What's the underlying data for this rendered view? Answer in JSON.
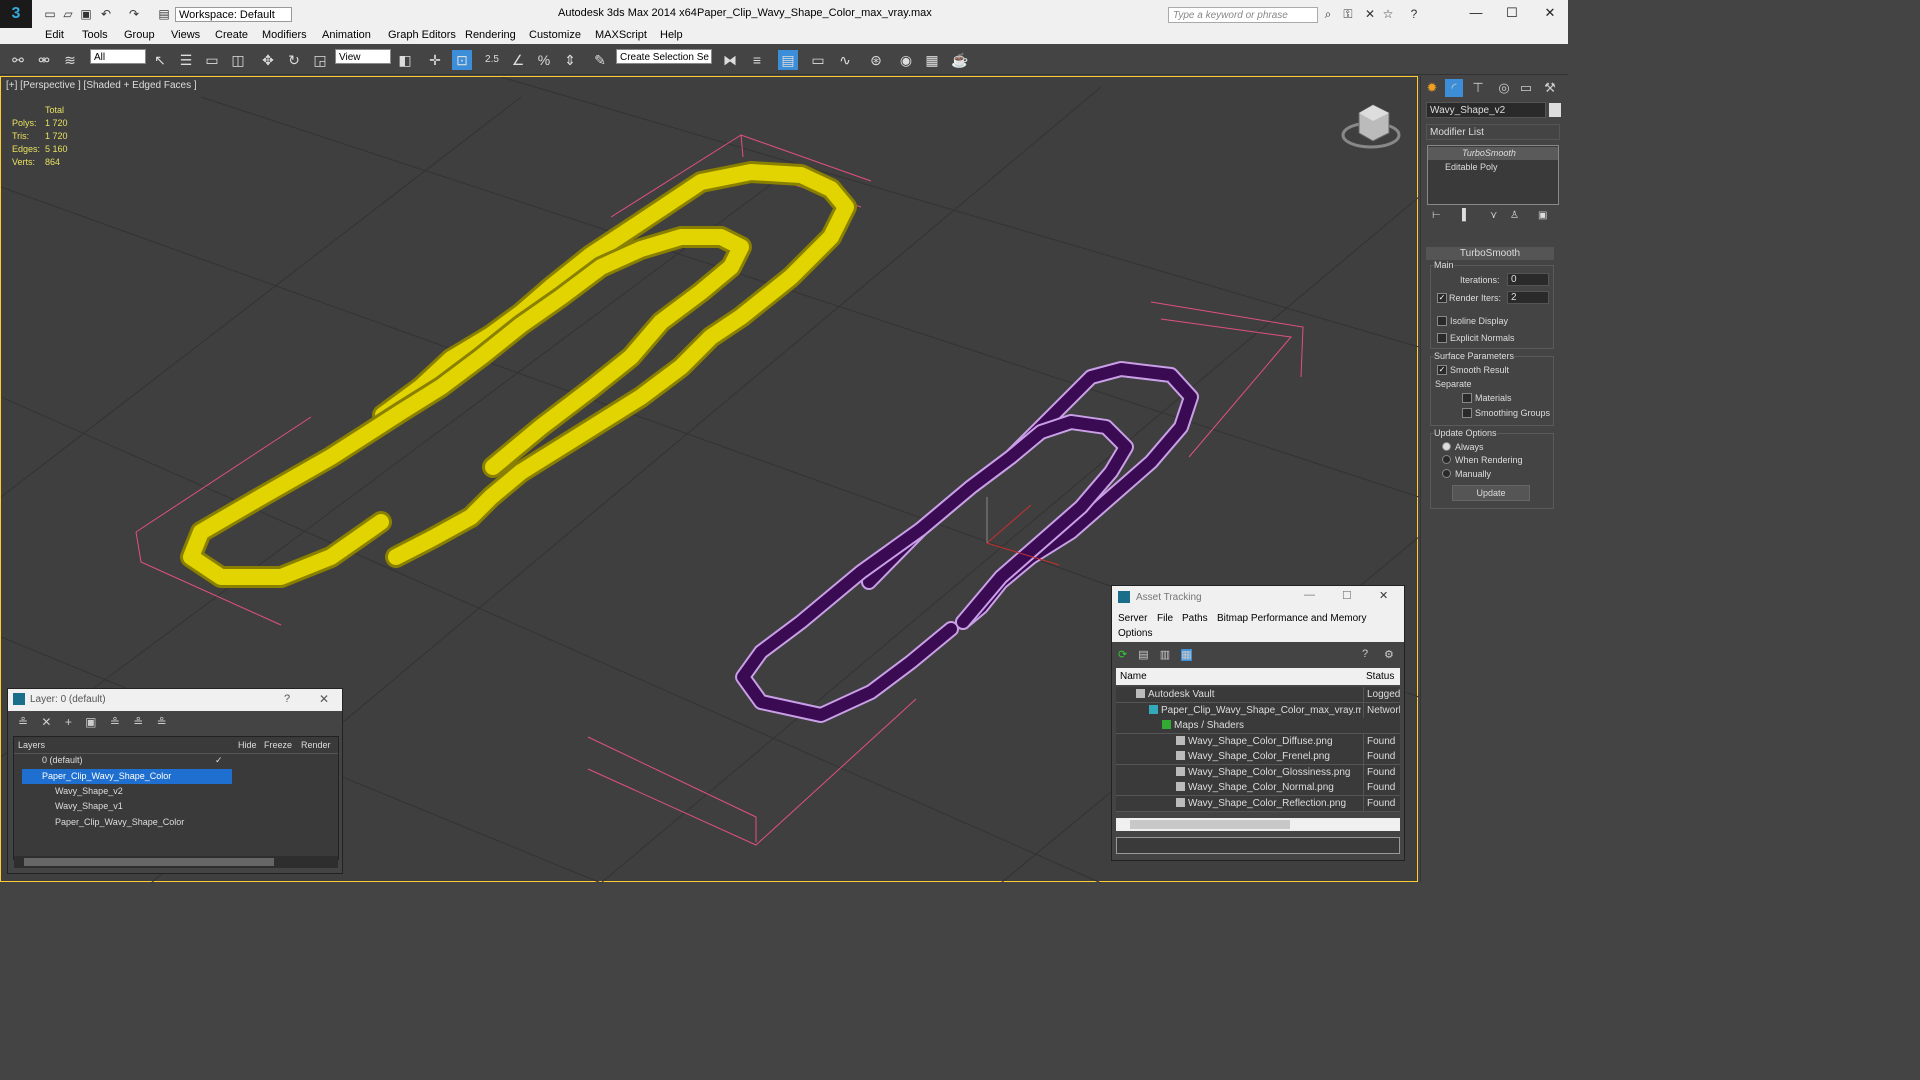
{
  "titlebar": {
    "app_title": "Autodesk 3ds Max  2014 x64",
    "file_title": "Paper_Clip_Wavy_Shape_Color_max_vray.max",
    "workspace": "Workspace: Default",
    "search_placeholder": "Type a keyword or phrase",
    "minimize": "—",
    "maximize": "☐",
    "close": "✕"
  },
  "menu": [
    "Edit",
    "Tools",
    "Group",
    "Views",
    "Create",
    "Modifiers",
    "Animation",
    "Graph Editors",
    "Rendering",
    "Customize",
    "MAXScript",
    "Help"
  ],
  "toolbar": {
    "filter_value": "All",
    "refcoord_value": "View",
    "selection_set": "Create Selection Se",
    "snap_label": "2.5"
  },
  "viewport": {
    "label": "[+] [Perspective ] [Shaded + Edged Faces ]",
    "stats": {
      "header": "Total",
      "rows": [
        {
          "label": "Polys:",
          "value": "1 720"
        },
        {
          "label": "Tris:",
          "value": "1 720"
        },
        {
          "label": "Edges:",
          "value": "5 160"
        },
        {
          "label": "Verts:",
          "value": "864"
        }
      ]
    }
  },
  "command_panel": {
    "object_name": "Wavy_Shape_v2",
    "modifier_list": "Modifier List",
    "stack": [
      "TurboSmooth",
      "Editable Poly"
    ],
    "turbosmooth": {
      "title": "TurboSmooth",
      "main": "Main",
      "iterations_label": "Iterations:",
      "iterations_value": "0",
      "render_iters_label": "Render Iters:",
      "render_iters_value": "2",
      "isoline": "Isoline Display",
      "explicit_normals": "Explicit Normals",
      "surface_params": "Surface Parameters",
      "smooth_result": "Smooth Result",
      "separate": "Separate",
      "materials": "Materials",
      "smoothing_groups": "Smoothing Groups",
      "update_options": "Update Options",
      "always": "Always",
      "when_rendering": "When Rendering",
      "manually": "Manually",
      "update_button": "Update"
    }
  },
  "layer_panel": {
    "title": "Layer: 0 (default)",
    "help": "?",
    "close": "✕",
    "columns": [
      "Layers",
      "Hide",
      "Freeze",
      "Render"
    ],
    "rows": [
      "0 (default)",
      "Paper_Clip_Wavy_Shape_Color",
      "Wavy_Shape_v2",
      "Wavy_Shape_v1",
      "Paper_Clip_Wavy_Shape_Color"
    ]
  },
  "asset_tracking": {
    "title": "Asset Tracking",
    "menu": [
      "Server",
      "File",
      "Paths",
      "Bitmap Performance and Memory",
      "Options"
    ],
    "columns": [
      "Name",
      "Status"
    ],
    "rows": [
      {
        "name": "Autodesk Vault",
        "status": "Logged"
      },
      {
        "name": "Paper_Clip_Wavy_Shape_Color_max_vray.max",
        "status": "Network"
      },
      {
        "name": "Maps / Shaders",
        "status": ""
      },
      {
        "name": "Wavy_Shape_Color_Diffuse.png",
        "status": "Found"
      },
      {
        "name": "Wavy_Shape_Color_Frenel.png",
        "status": "Found"
      },
      {
        "name": "Wavy_Shape_Color_Glossiness.png",
        "status": "Found"
      },
      {
        "name": "Wavy_Shape_Color_Normal.png",
        "status": "Found"
      },
      {
        "name": "Wavy_Shape_Color_Reflection.png",
        "status": "Found"
      }
    ]
  },
  "colors": {
    "viewport_bg": "#3f3f3f",
    "yellow_clip": "#e2d400",
    "purple_clip": "#3a0a52",
    "selection_bracket": "#e05080",
    "layer_selected": "#1e6fd0"
  }
}
